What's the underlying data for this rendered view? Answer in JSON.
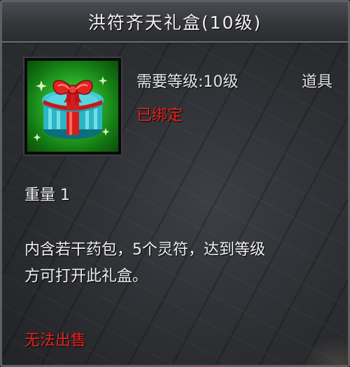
{
  "item": {
    "title": "洪符齐天礼盒(10级)",
    "icon": "gift-box-icon",
    "required_level": "需要等级:10级",
    "type": "道具",
    "bound_status": "已绑定",
    "weight": "重量 1",
    "description_lines": [
      "内含若干药包，5个灵符，达到等级",
      "方可打开此礼盒。"
    ],
    "sell_status": "无法出售"
  },
  "colors": {
    "text_primary": "#f0f0f0",
    "text_warning": "#e8221c",
    "icon_background": "#2fb32c",
    "panel_border": "#5d6066"
  }
}
